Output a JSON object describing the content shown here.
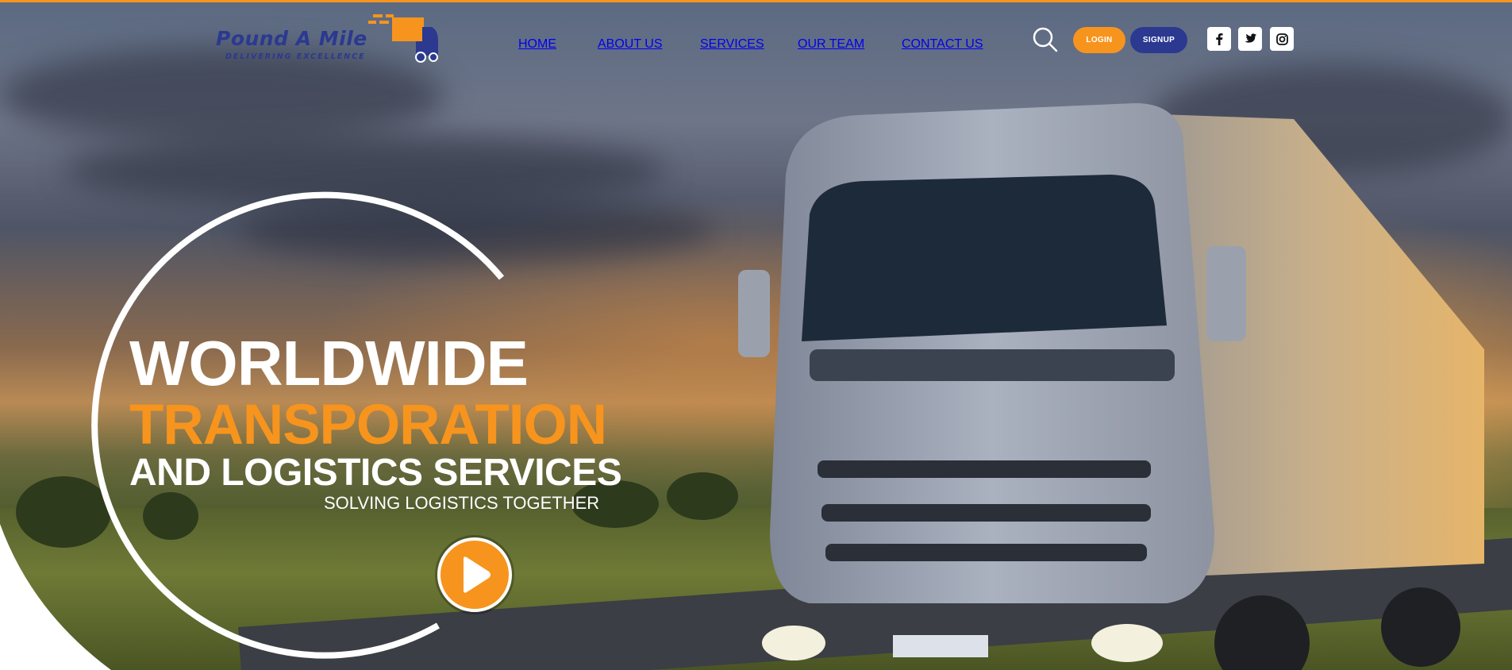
{
  "header": {
    "logo": {
      "title": "Pound A Mile",
      "subtitle": "DELIVERING EXCELLENCE",
      "icon": "delivery-truck-icon"
    },
    "nav": [
      {
        "label": "HOME"
      },
      {
        "label": "ABOUT US"
      },
      {
        "label": "SERVICES"
      },
      {
        "label": "OUR TEAM"
      },
      {
        "label": "CONTACT US"
      }
    ],
    "search_icon": "search-icon",
    "login_label": "LOGIN",
    "signup_label": "SIGNUP",
    "social": [
      {
        "icon": "facebook-icon"
      },
      {
        "icon": "twitter-icon"
      },
      {
        "icon": "instagram-icon"
      }
    ]
  },
  "hero": {
    "line1": "WORLDWIDE",
    "line2": "TRANSPORATION",
    "line3": "AND LOGISTICS SERVICES",
    "tagline": "SOLVING LOGISTICS TOGETHER",
    "play_icon": "play-icon"
  },
  "colors": {
    "accent": "#f7941d",
    "brand": "#2b3990",
    "text": "#ffffff"
  }
}
